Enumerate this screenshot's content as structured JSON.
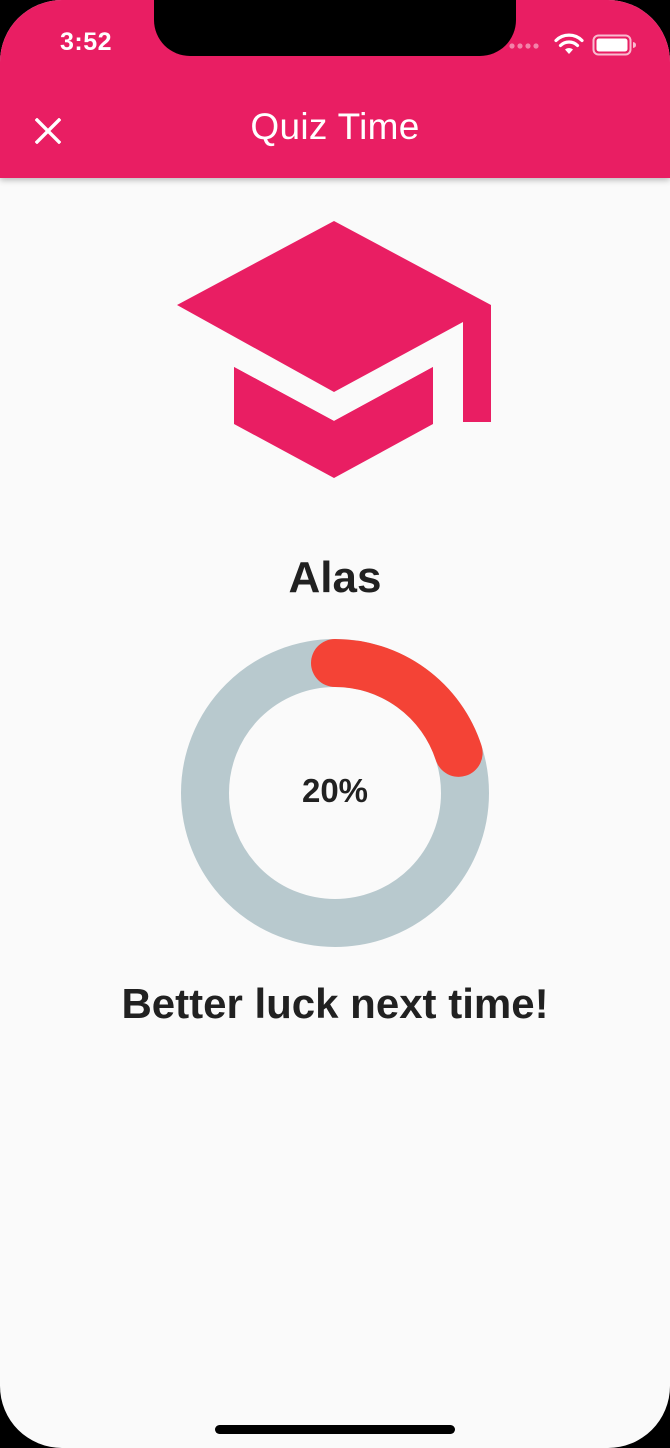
{
  "status_bar": {
    "time": "3:52",
    "icons": [
      "cellular-signal-icon",
      "wifi-icon",
      "battery-icon"
    ]
  },
  "app_bar": {
    "title": "Quiz Time",
    "close_icon": "close-icon",
    "color": "#e91e63"
  },
  "hero_icon": "graduation-cap-icon",
  "result": {
    "title": "Alas",
    "score_percent": 20,
    "score_label": "20%",
    "message": "Better luck next time!"
  },
  "colors": {
    "accent": "#e91e63",
    "progress": "#f44336",
    "track": "#b8c9ce",
    "text": "#212121",
    "background": "#fafafa"
  }
}
